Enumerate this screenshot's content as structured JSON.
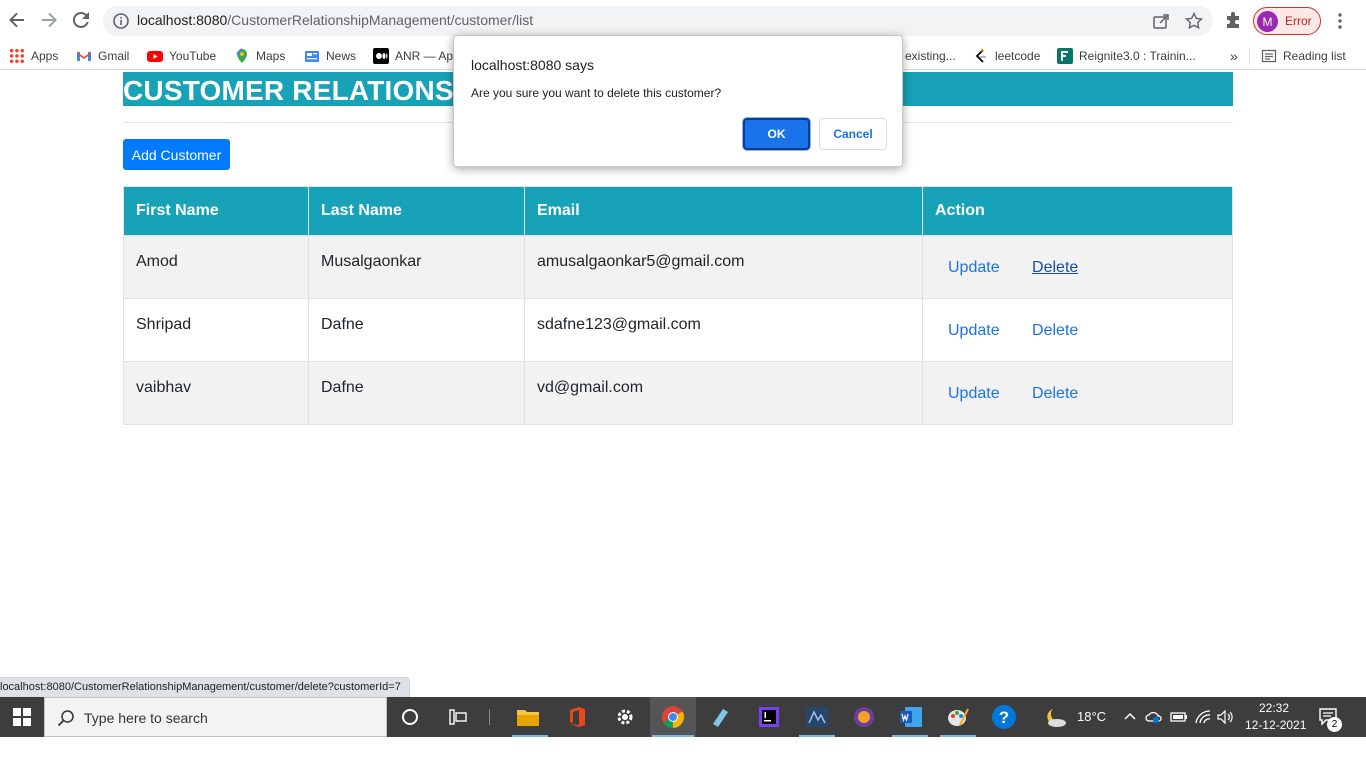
{
  "browser": {
    "url_host": "localhost:8080",
    "url_path": "/CustomerRelationshipManagement/customer/list",
    "profile_initial": "M",
    "profile_label": "Error",
    "bookmarks": [
      {
        "label": "Apps",
        "icon": "apps-grid-icon"
      },
      {
        "label": "Gmail",
        "icon": "gmail-icon"
      },
      {
        "label": "YouTube",
        "icon": "youtube-icon"
      },
      {
        "label": "Maps",
        "icon": "maps-icon"
      },
      {
        "label": "News",
        "icon": "news-icon"
      },
      {
        "label": "ANR — Ap",
        "icon": "medium-icon"
      },
      {
        "label": "existing...",
        "icon": ""
      },
      {
        "label": "leetcode",
        "icon": "leetcode-icon"
      },
      {
        "label": "Reignite3.0 : Trainin...",
        "icon": "forms-icon"
      }
    ],
    "bookmarks_overflow": "»",
    "reading_list": "Reading list",
    "status_url": "localhost:8080/CustomerRelationshipManagement/customer/delete?customerId=7"
  },
  "page": {
    "title": "CUSTOMER RELATIONSHIP MANAGER",
    "add_button": "Add Customer",
    "table": {
      "headers": [
        "First Name",
        "Last Name",
        "Email",
        "Action"
      ],
      "rows": [
        {
          "first": "Amod",
          "last": "Musalgaonkar",
          "email": "amusalgaonkar5@gmail.com",
          "update": "Update",
          "delete": "Delete"
        },
        {
          "first": "Shripad",
          "last": "Dafne",
          "email": "sdafne123@gmail.com",
          "update": "Update",
          "delete": "Delete"
        },
        {
          "first": "vaibhav",
          "last": "Dafne",
          "email": "vd@gmail.com",
          "update": "Update",
          "delete": "Delete"
        }
      ]
    }
  },
  "dialog": {
    "title": "localhost:8080 says",
    "message": "Are you sure you want to delete this customer?",
    "ok": "OK",
    "cancel": "Cancel"
  },
  "taskbar": {
    "search_placeholder": "Type here to search",
    "temperature": "18°C",
    "time": "22:32",
    "date": "12-12-2021",
    "notification_count": "2"
  },
  "colors": {
    "teal": "#17a2b8",
    "primary": "#007bff",
    "link": "#1a73e8"
  }
}
